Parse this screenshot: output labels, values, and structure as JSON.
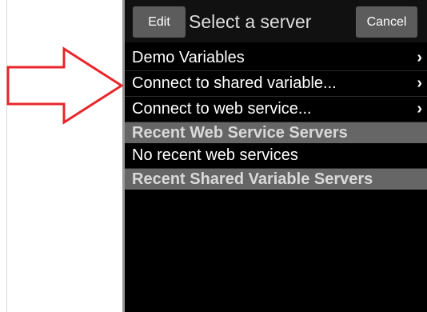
{
  "navbar": {
    "edit_label": "Edit",
    "title": "Select a server",
    "cancel_label": "Cancel"
  },
  "menu_items": [
    {
      "label": "Demo Variables",
      "chevron": "›"
    },
    {
      "label": "Connect to shared variable...",
      "chevron": "›"
    },
    {
      "label": "Connect to web service...",
      "chevron": "›"
    }
  ],
  "sections": {
    "recent_web": {
      "header": "Recent Web Service Servers",
      "empty_text": "No recent web services"
    },
    "recent_shared": {
      "header": "Recent Shared Variable Servers"
    }
  },
  "annotation": {
    "icon": "right-arrow-outline-icon",
    "color": "#e8252b"
  },
  "colors": {
    "screen_background": "#000000",
    "nav_button": "#5c5c5c",
    "section_header": "#666666"
  }
}
